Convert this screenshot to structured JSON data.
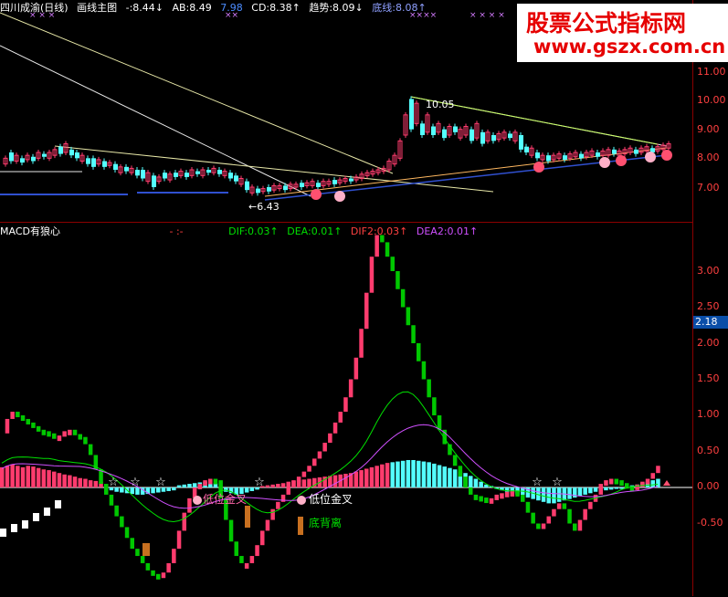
{
  "price_header": {
    "title": "四川成渝(日线)",
    "indicator": "画线主图",
    "v1": "-:8.44↓",
    "ab": "AB:8.49",
    "v2": "7.98",
    "cd": "CD:8.38↑",
    "trend": "趋势:8.09↓",
    "bottom": "底线:8.08↑",
    "marks_left": "× × ×",
    "marks_mid": "××",
    "marks_right": "××××",
    "marks_far": "× × × ×"
  },
  "macd_header": {
    "title": "MACD有狼心",
    "sep": "- :-",
    "dif": "DIF:0.03↑",
    "dea": "DEA:0.01↑",
    "dif2": "DIF2:0.03↑",
    "dea2": "DEA2:0.01↑"
  },
  "price_axis": [
    "11.00",
    "10.00",
    "9.00",
    "8.00",
    "7.00"
  ],
  "macd_axis": [
    "3.00",
    "2.50",
    "2.00",
    "1.50",
    "1.00",
    "0.50",
    "0.00",
    "-0.50"
  ],
  "current_value": "2.18",
  "annotations": {
    "high": "10.05",
    "low": "←6.43",
    "golden_cross_1": "低位金叉",
    "golden_cross_2": "低位金叉",
    "divergence": "底背离"
  },
  "watermark": {
    "title": "股票公式指标网",
    "url": "www.gszx.com.cn"
  },
  "colors": {
    "up": "#ff3c6e",
    "down": "#00c800",
    "cyan": "#54ffff",
    "blue": "#4c8cff",
    "yellow": "#ffff66",
    "white": "#ffffff",
    "axis_red": "#ff4040"
  },
  "chart_data": {
    "type": "bar",
    "title": "MACD有狼心",
    "series": [
      {
        "name": "DIF",
        "last": 0.03
      },
      {
        "name": "DEA",
        "last": 0.01
      },
      {
        "name": "DIF2",
        "last": 0.03
      },
      {
        "name": "DEA2",
        "last": 0.01
      }
    ],
    "ylim": [
      -0.75,
      3.2
    ],
    "price_ylim": [
      6.0,
      11.5
    ],
    "price_high": 10.05,
    "price_low": 6.43
  }
}
